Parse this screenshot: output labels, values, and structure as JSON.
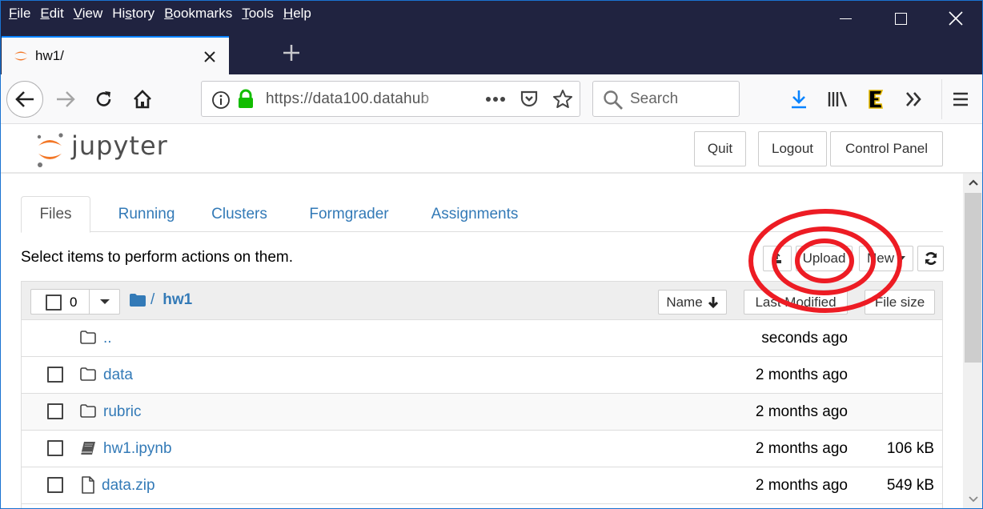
{
  "browser": {
    "menu": [
      {
        "accel": "F",
        "rest": "ile"
      },
      {
        "accel": "E",
        "rest": "dit"
      },
      {
        "accel": "V",
        "rest": "iew"
      },
      {
        "pre": "Hi",
        "accel": "s",
        "rest": "tory"
      },
      {
        "accel": "B",
        "rest": "ookmarks"
      },
      {
        "accel": "T",
        "rest": "ools"
      },
      {
        "accel": "H",
        "rest": "elp"
      }
    ],
    "menu_labels": [
      "File",
      "Edit",
      "View",
      "History",
      "Bookmarks",
      "Tools",
      "Help"
    ],
    "tab_title": "hw1/",
    "tab_close": "✕",
    "new_tab": "+",
    "url": "https://data100.datahub",
    "search_placeholder": "Search",
    "window_close": "✕",
    "colors": {
      "chrome_dark": "#202340",
      "accent": "#0a84ff",
      "lock_green": "#12bc00"
    }
  },
  "jupyter": {
    "logo_text": "jupyter",
    "header_buttons": {
      "quit": "Quit",
      "logout": "Logout",
      "control_panel": "Control Panel"
    },
    "tabs": [
      {
        "label": "Files",
        "active": true
      },
      {
        "label": "Running",
        "active": false
      },
      {
        "label": "Clusters",
        "active": false
      },
      {
        "label": "Formgrader",
        "active": false
      },
      {
        "label": "Assignments",
        "active": false
      }
    ],
    "instructions": "Select items to perform actions on them.",
    "toolbar": {
      "upload": "Upload",
      "new": "New"
    },
    "list": {
      "selected_count": "0",
      "breadcrumb_sep": "/",
      "breadcrumb_dir": "hw1",
      "sort_name": "Name",
      "sort_modified": "Last Modified",
      "sort_size": "File size",
      "rows": [
        {
          "name": "..",
          "type": "folder",
          "modified": "seconds ago",
          "size": "",
          "checkbox": false
        },
        {
          "name": "data",
          "type": "folder",
          "modified": "2 months ago",
          "size": "",
          "checkbox": true
        },
        {
          "name": "rubric",
          "type": "folder",
          "modified": "2 months ago",
          "size": "",
          "checkbox": true
        },
        {
          "name": "hw1.ipynb",
          "type": "notebook",
          "modified": "2 months ago",
          "size": "106 kB",
          "checkbox": true
        },
        {
          "name": "data.zip",
          "type": "file",
          "modified": "2 months ago",
          "size": "549 kB",
          "checkbox": true
        }
      ]
    },
    "colors": {
      "link": "#337ab7",
      "logo_orange": "#f37726"
    }
  },
  "annotation": {
    "type": "concentric-circles",
    "target": "Upload",
    "color": "#ed1c24"
  }
}
